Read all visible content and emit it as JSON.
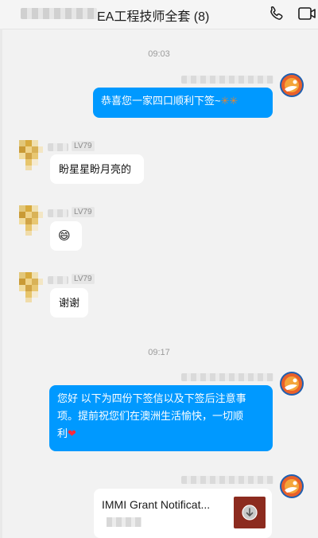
{
  "header": {
    "title": "EA工程技师全套 (8)",
    "call_icon": "phone-icon",
    "video_icon": "video-call-icon"
  },
  "messages": {
    "time1": "09:03",
    "msg1": "恭喜您一家四口顺利下签~",
    "msg1_emoji": "✳✳",
    "member1_level": "LV79",
    "msg2": "盼星星盼月亮的",
    "member2_level": "LV79",
    "msg3_emoji": "😄",
    "member3_level": "LV79",
    "msg4": "谢谢",
    "time2": "09:17",
    "msg5_line1": "您好 以下为四份下签信以及下签后注意事",
    "msg5_line2": "项。提前祝您们在澳洲生活愉快，一切顺",
    "msg5_line3": "利",
    "msg5_emoji": "❤"
  },
  "file": {
    "name": "IMMI Grant Notificat...",
    "icon": "download-icon"
  },
  "colors": {
    "outgoing_bubble": "#0099ff",
    "incoming_bubble": "#ffffff",
    "background": "#f2f2f2",
    "file_thumb": "#8c2b1f"
  }
}
